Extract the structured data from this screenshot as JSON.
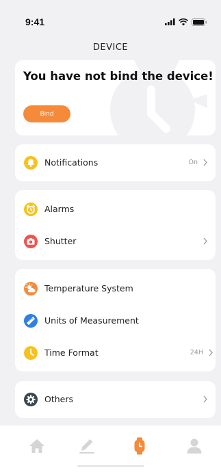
{
  "status_bar": {
    "time": "9:41"
  },
  "page_title": "DEVICE",
  "hero": {
    "title": "You have not bind the device!",
    "bind_label": "Bind"
  },
  "group_notifications": {
    "items": [
      {
        "icon": "bell-icon",
        "label": "Notifications",
        "value": "On"
      }
    ]
  },
  "group_alarms": {
    "items": [
      {
        "icon": "alarm-clock-icon",
        "label": "Alarms"
      },
      {
        "icon": "camera-icon",
        "label": "Shutter"
      }
    ]
  },
  "group_settings": {
    "items": [
      {
        "icon": "weather-icon",
        "label": "Temperature System"
      },
      {
        "icon": "ruler-icon",
        "label": "Units of Measurement"
      },
      {
        "icon": "clock-icon",
        "label": "Time Format",
        "value": "24H"
      }
    ]
  },
  "group_others": {
    "items": [
      {
        "icon": "gear-icon",
        "label": "Others"
      }
    ]
  },
  "bottom_nav": {
    "items": [
      {
        "icon": "home-icon",
        "active": false
      },
      {
        "icon": "edit-icon",
        "active": false
      },
      {
        "icon": "watch-icon",
        "active": true
      },
      {
        "icon": "profile-icon",
        "active": false
      }
    ]
  },
  "colors": {
    "accent": "#f58a3a",
    "yellow": "#f8c21c",
    "red": "#f0524f",
    "blue": "#2f7fe6",
    "dark": "#3c4654",
    "nav_inactive": "#d5d5d5"
  }
}
